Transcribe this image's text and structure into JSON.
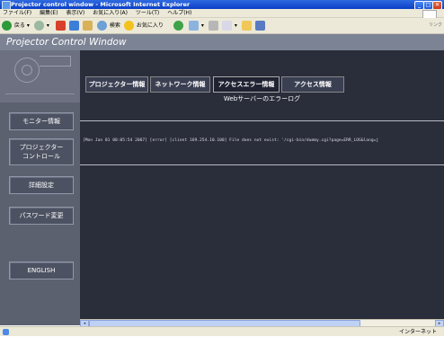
{
  "window": {
    "title": "Projector control window - Microsoft Internet Explorer",
    "controls": [
      "minimize-icon",
      "maximize-icon",
      "close-icon"
    ]
  },
  "menubar": [
    "ファイル(F)",
    "編集(E)",
    "表示(V)",
    "お気に入り(A)",
    "ツール(T)",
    "ヘルプ(H)"
  ],
  "toolbar": {
    "back_label": "戻る",
    "search_label": "検索",
    "favorites_label": "お気に入り",
    "links_label": "リンク"
  },
  "page": {
    "title": "Projector Control Window",
    "sidebar": [
      "モニター情報",
      "プロジェクター\nコントロール",
      "詳細設定",
      "パスワード変更",
      "ENGLISH"
    ],
    "tabs": [
      "プロジェクター情報",
      "ネットワーク情報",
      "アクセスエラー情報",
      "アクセス情報"
    ],
    "active_tab": 2,
    "log_title": "Webサーバーのエラーログ",
    "log_entry": "[Mon Jan 01 08:05:54 2007] [error] [client 169.254.10.100] File does not exist: '/cgi-bin/dummy.cgi?page=ERR_LOG&lang=j"
  },
  "statusbar": {
    "zone": "インターネット"
  },
  "colors": {
    "title_bar": "#0b3fc6",
    "page_header": "#7c8394",
    "sidebar": "#5c6170",
    "content_bg": "#2a2d3a"
  }
}
